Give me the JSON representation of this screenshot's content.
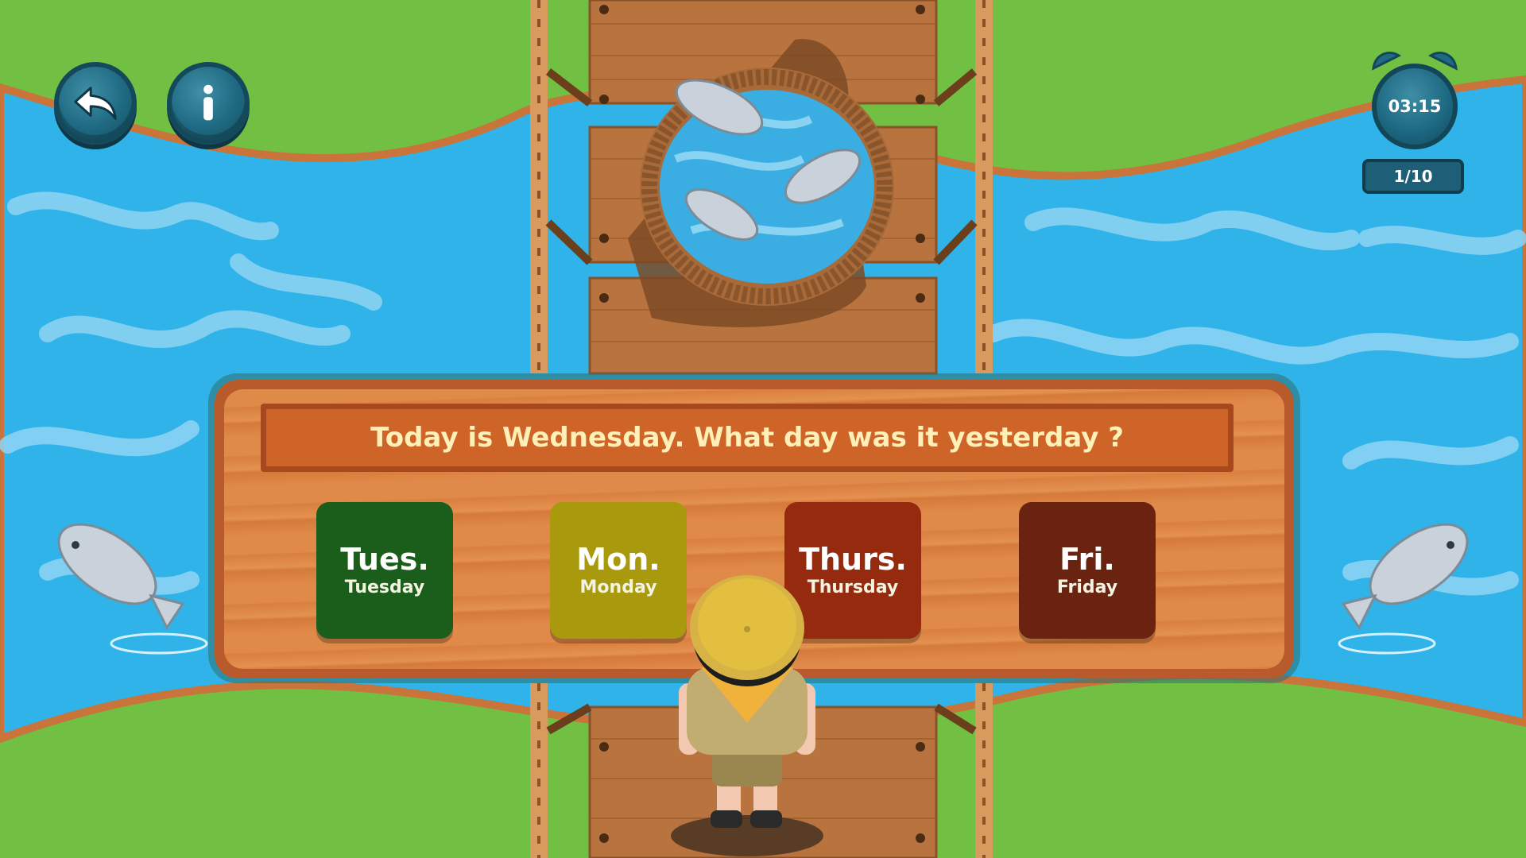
{
  "question": "Today is Wednesday. What day was it yesterday ?",
  "timer": "03:15",
  "progress": "1/10",
  "buttons": {
    "back_icon": "back-arrow-icon",
    "info_icon": "info-icon"
  },
  "options": [
    {
      "abbr": "Tues.",
      "full": "Tuesday",
      "color": "#1b5e1c"
    },
    {
      "abbr": "Mon.",
      "full": "Monday",
      "color": "#a89a0c"
    },
    {
      "abbr": "Thurs.",
      "full": "Thursday",
      "color": "#962a0f"
    },
    {
      "abbr": "Fri.",
      "full": "Friday",
      "color": "#6a2310"
    }
  ],
  "colors": {
    "grass": "#6fbf3f",
    "water": "#2bb0e6",
    "wood": "#e08a49",
    "button": "#1f6a82"
  }
}
